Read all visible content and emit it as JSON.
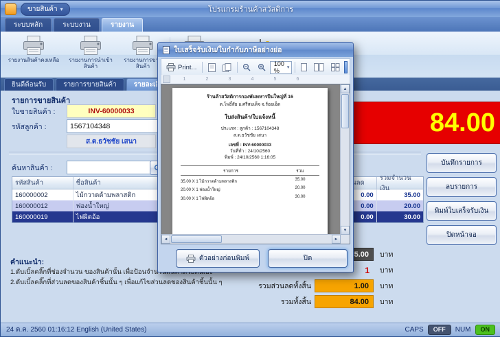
{
  "window": {
    "title": "โปรแกรมร้านค้าสวัสดิการ",
    "quick_button": "ขายสินค้า"
  },
  "ribbon": {
    "tabs": [
      {
        "label": "ระบบหลัก"
      },
      {
        "label": "ระบบงาน"
      },
      {
        "label": "รายงาน"
      }
    ],
    "items": [
      {
        "label": "รายงานสินค้าคงเหลือ"
      },
      {
        "label": "รายงานการนำเข้าสินค้า"
      },
      {
        "label": "รายงานการขายสินค้า"
      }
    ]
  },
  "page_tabs": [
    {
      "label": "ยินดีต้อนรับ"
    },
    {
      "label": "รายการขายสินค้า"
    },
    {
      "label": "รายละเอียดการขาย"
    }
  ],
  "sale": {
    "section_title": "รายการขายสินค้า",
    "invoice_label": "ใบขายสินค้า :",
    "invoice_no": "INV-60000033",
    "customer_label": "รหัสลูกค้า :",
    "customer_id": "1567104348",
    "customer_name": "ส.ต.ธวัชชัย เสนา",
    "search_label": "ค้นหาสินค้า :",
    "total_display": "84.00"
  },
  "table": {
    "headers": [
      "รหัสสินค้า",
      "ชื่อสินค้า",
      "",
      "ส่วนลด",
      "รวมจำนวนเงิน"
    ],
    "rows": [
      {
        "code": "160000002",
        "name": "ไม้กวาดด้ามพลาสติก",
        "discount": "0.00",
        "total": "35.00"
      },
      {
        "code": "160000012",
        "name": "ฟองน้ำใหญ่",
        "discount": "0.00",
        "total": "20.00"
      },
      {
        "code": "160000019",
        "name": "ไฟผิดอ้อ",
        "discount": "0.00",
        "total": "30.00"
      }
    ]
  },
  "actions": [
    {
      "label": "บันทึกรายการ"
    },
    {
      "label": "ลบรายการ"
    },
    {
      "label": "พิมพ์ใบเสร็จรับเงิน"
    },
    {
      "label": "ปิดหน้าจอ"
    }
  ],
  "summary": {
    "subtotal": "85.00",
    "item_count": "1",
    "discount_label": "รวมส่วนลดทั้งสิ้น",
    "discount": "1.00",
    "grand_label": "รวมทั้งสิ้น",
    "grand": "84.00",
    "currency": "บาท"
  },
  "instructions": {
    "title": "คำแนะนำ:",
    "line1": "1.ดับเบิ้ลคลิ๊กที่ช่องจำนวน ของสินค้านั้น เพื่อป้อนจำนวนสินค้าด้วยตนเอง",
    "line2": "2.ดับเบิ้ลคลิ๊กที่ส่วนลดของสินค้าชิ้นนั้น ๆ เพื่อแก้ไขส่วนลดของสินค้าชิ้นนั้น ๆ"
  },
  "statusbar": {
    "datetime": "24 ต.ค. 2560 01:16:12 English (United States)",
    "caps_label": "CAPS",
    "caps_state": "OFF",
    "num_label": "NUM",
    "num_state": "ON"
  },
  "dialog": {
    "title": "ใบเสร็จรับเงิน/ใบกำกับภาษีอย่างย่อ",
    "toolbar": {
      "print": "Print...",
      "zoom": "100 %"
    },
    "ruler": [
      "1",
      "2",
      "3",
      "4",
      "5",
      "6"
    ],
    "receipt": {
      "store_line1": "ร้านค้าสวัสดิการกองพันทหารปืนใหญ่ที่ 16",
      "store_line2": "ต.โพธิ์สัย อ.ศรีสมเด็จ จ.ร้อยเอ็ด",
      "doc_title": "ใบส่งสินค้า/ใบแจ้งหนี้",
      "customer_line": "ประเภท : ลูกค้า : 1567104348",
      "customer_name": "ส.ต.ธวัชชัย เสนา",
      "number": "เลขที่ : INV-60000033",
      "date": "วันที่ทำ : 24/10/2560",
      "printed": "พิมพ์ : 24/10/2560 1:16:05",
      "col_item": "รายการ",
      "col_total": "รวม",
      "items": [
        {
          "desc": "35.00 X 1 ไม้กวาดด้ามพลาสติก",
          "amount": "35.00"
        },
        {
          "desc": "20.00 X 1 ฟองน้ำใหญ่",
          "amount": "20.00"
        },
        {
          "desc": "30.00 X 1 ไฟผิดอ้อ",
          "amount": "30.00"
        }
      ]
    },
    "buttons": {
      "preview": "ตัวอย่างก่อนพิมพ์",
      "close": "ปิด"
    }
  },
  "colors": {
    "accent_red": "#e60000",
    "total_text": "#ffff00",
    "gold": "#f7a400",
    "selected_row": "#25388f"
  }
}
